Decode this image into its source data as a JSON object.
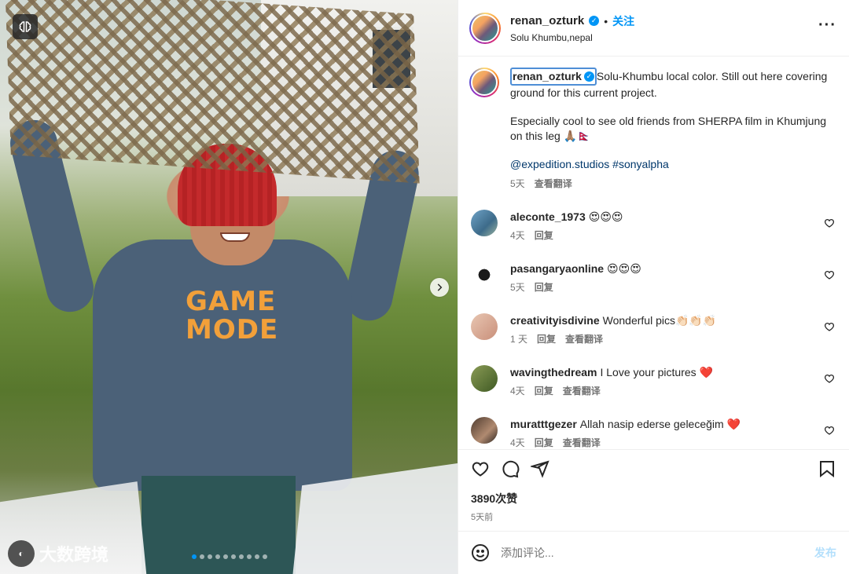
{
  "post": {
    "username": "renan_ozturk",
    "follow_label": "关注",
    "location": "Solu Khumbu,nepal",
    "separator": "•"
  },
  "photo": {
    "shirt_text_line1": "GAME",
    "shirt_text_line2": "MODE",
    "watermark_text": "大数跨境",
    "carousel": {
      "dots": 10,
      "active": 0
    }
  },
  "caption": {
    "username": "renan_ozturk",
    "text1": "Solu-Khumbu local color. Still out here covering ground for this current project.",
    "text2": "Especially cool to see old friends from SHERPA film in Khumjung on this leg 🙏🏽🇳🇵",
    "tags": "@expedition.studios #sonyalpha",
    "time": "5天",
    "translate": "查看翻译"
  },
  "comments": [
    {
      "user": "aleconte_1973",
      "text": "😍😍😍",
      "time": "4天",
      "reply": "回复",
      "translate": ""
    },
    {
      "user": "pasangaryaonline",
      "text": "😍😍😍",
      "time": "5天",
      "reply": "回复",
      "translate": ""
    },
    {
      "user": "creativityisdivine",
      "text": "Wonderful pics👏🏻👏🏻👏🏻",
      "time": "1 天",
      "reply": "回复",
      "translate": "查看翻译"
    },
    {
      "user": "wavingthedream",
      "text": "I Love your pictures ❤️",
      "time": "4天",
      "reply": "回复",
      "translate": "查看翻译"
    },
    {
      "user": "muratttgezer",
      "text": "Allah nasip ederse geleceğim ❤️",
      "time": "4天",
      "reply": "回复",
      "translate": "查看翻译"
    }
  ],
  "engagement": {
    "likes": "3890次赞",
    "posted_ago": "5天前"
  },
  "composer": {
    "placeholder": "添加评论...",
    "post_label": "发布"
  },
  "colors": {
    "accent": "#0095f6",
    "post_disabled": "#b2dffc",
    "muted": "#737373",
    "text": "#262626"
  },
  "icons": [
    "brain-icon",
    "chevron-right-icon",
    "verified-badge-icon",
    "more-options-icon",
    "heart-icon",
    "comment-icon",
    "share-icon",
    "bookmark-icon",
    "emoji-icon"
  ]
}
